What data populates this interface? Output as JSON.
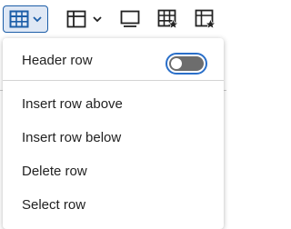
{
  "toolbar": {
    "buttons": [
      {
        "name": "table-icon",
        "dropdown": true,
        "active": true
      },
      {
        "name": "table-layout-icon",
        "dropdown": true,
        "active": false
      },
      {
        "name": "table-properties-icon",
        "dropdown": false,
        "active": false
      },
      {
        "name": "table-cell-properties-icon",
        "dropdown": false,
        "active": false
      },
      {
        "name": "table-cell-star-icon",
        "dropdown": false,
        "active": false
      }
    ]
  },
  "menu": {
    "header_row": {
      "label": "Header row",
      "toggle_on": false
    },
    "items": [
      {
        "label": "Insert row above"
      },
      {
        "label": "Insert row below"
      },
      {
        "label": "Delete row"
      },
      {
        "label": "Select row"
      }
    ]
  },
  "colors": {
    "accent": "#1d5ea8",
    "active_bg": "#dfe8f5",
    "toggle_border": "#2a6fc9",
    "toggle_off": "#6d6d6d"
  }
}
